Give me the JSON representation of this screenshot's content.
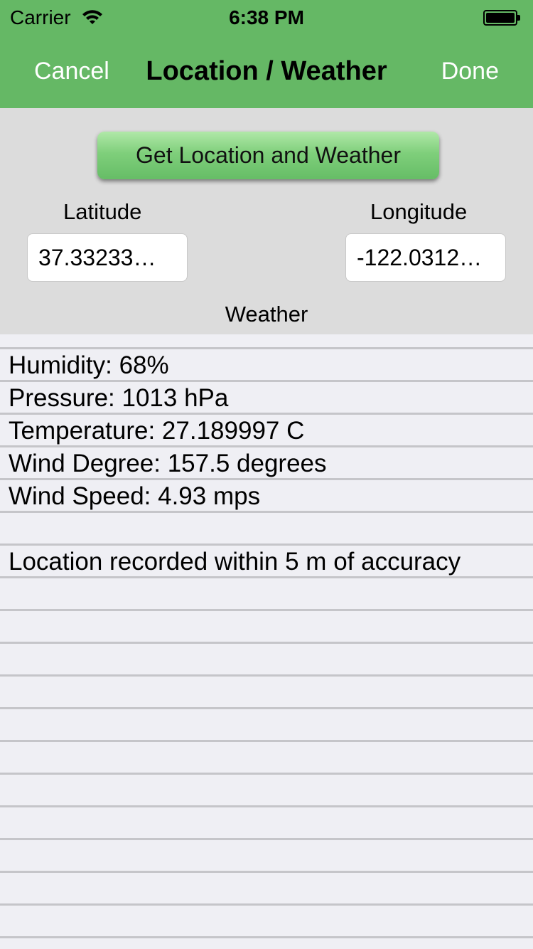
{
  "status_bar": {
    "carrier": "Carrier",
    "time": "6:38 PM"
  },
  "nav": {
    "cancel_label": "Cancel",
    "title": "Location / Weather",
    "done_label": "Done"
  },
  "controls": {
    "get_button_label": "Get Location and Weather",
    "latitude_label": "Latitude",
    "latitude_value": "37.33233…",
    "longitude_label": "Longitude",
    "longitude_value": "-122.0312…",
    "weather_label": "Weather"
  },
  "weather_lines": [
    "Humidity: 68%",
    "Pressure: 1013 hPa",
    "Temperature: 27.189997 C",
    "Wind Degree: 157.5 degrees",
    "Wind Speed: 4.93 mps",
    "",
    "Location recorded within 5 m of accuracy"
  ],
  "colors": {
    "nav_green": "#65b865",
    "button_green": "#7fcf7b",
    "panel_gray": "#dcdcdc",
    "paper": "#efeff4"
  },
  "icons": {
    "wifi": "wifi-icon",
    "battery": "battery-icon"
  }
}
